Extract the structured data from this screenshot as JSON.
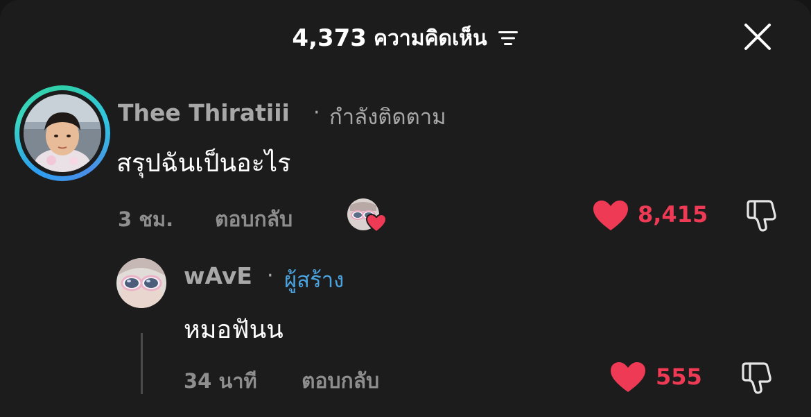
{
  "header": {
    "comment_count": "4,373",
    "comments_label": "ความคิดเห็น",
    "sort_icon": "sort-lines-icon",
    "close_icon": "close-x-icon"
  },
  "comments": [
    {
      "username": "Thee Thiratiii",
      "separator": "·",
      "relation": "กำลังติดตาม",
      "text": "สรุปฉันเป็นอะไร",
      "time": "3 ชม.",
      "reply_label": "ตอบกลับ",
      "likes": "8,415"
    }
  ],
  "replies": [
    {
      "username": "wAvE",
      "separator": "·",
      "badge": "ผู้สร้าง",
      "text": "หมอฟันน",
      "time": "34 นาที",
      "reply_label": "ตอบกลับ",
      "likes": "555"
    }
  ],
  "colors": {
    "background": "#1c1c1c",
    "like_red": "#ee3a55",
    "creator_blue": "#4aa3df",
    "muted_text": "#a8a8a8"
  }
}
